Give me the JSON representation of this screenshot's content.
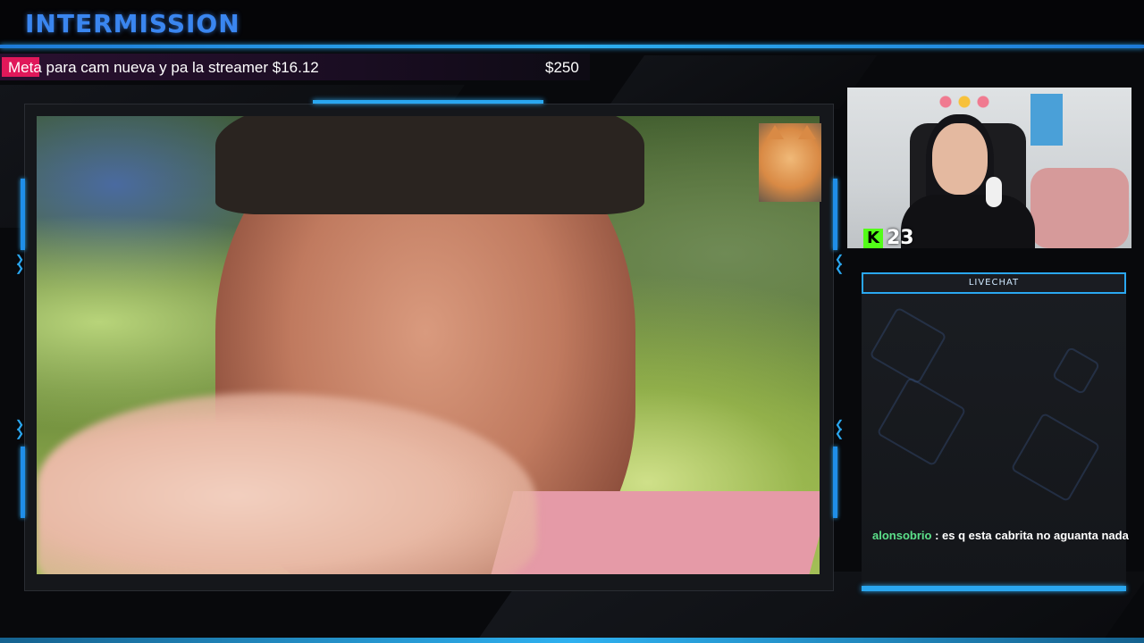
{
  "header": {
    "title": "INTERMISSION"
  },
  "goal": {
    "label": "Meta para cam nueva y pa la streamer $16.12",
    "target": "$250",
    "progress_fraction": 0.0645,
    "fill_color": "#e0185a"
  },
  "colors": {
    "accent": "#2aa7f0",
    "title": "#3a86f0",
    "chat_user": "#5ce08a"
  },
  "stream": {
    "platform_icon": "kick-icon",
    "platform_glyph": "K",
    "viewer_count": "23"
  },
  "chat": {
    "header": "LIVECHAT",
    "messages": [
      {
        "user": "alonsobrio",
        "separator": " : ",
        "text": "es q esta cabrita no aguanta nada"
      }
    ]
  }
}
